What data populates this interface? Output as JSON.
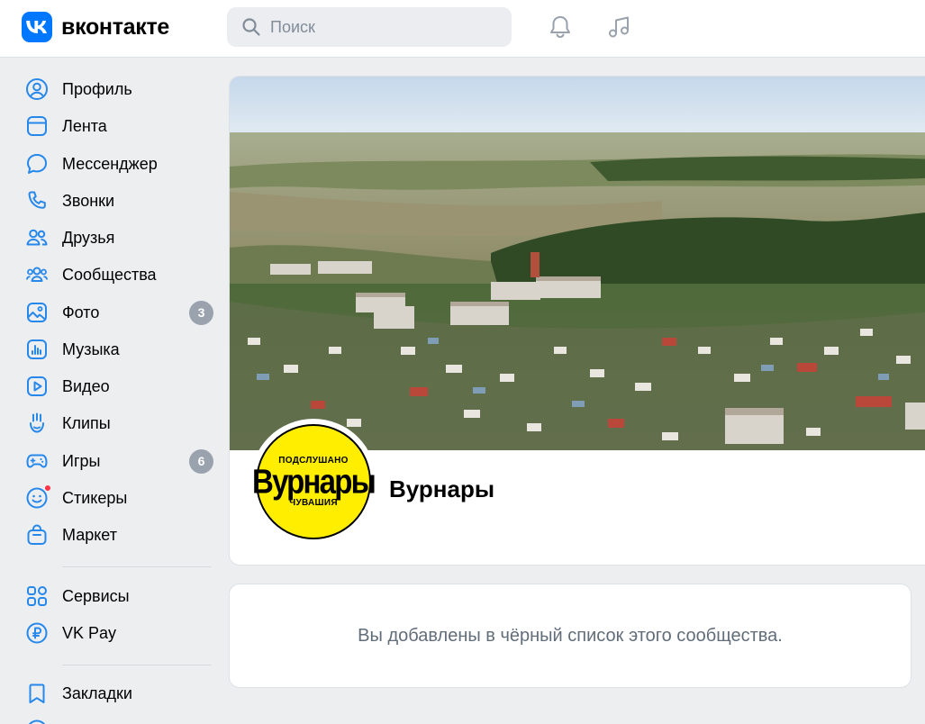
{
  "header": {
    "logo_text": "вконтакте",
    "search_placeholder": "Поиск",
    "icons": [
      "vk-logo-icon",
      "search-icon",
      "bell-icon",
      "music-note-icon"
    ]
  },
  "sidebar": {
    "items": [
      {
        "label": "Профиль",
        "icon": "profile-icon"
      },
      {
        "label": "Лента",
        "icon": "feed-icon"
      },
      {
        "label": "Мессенджер",
        "icon": "messenger-icon"
      },
      {
        "label": "Звонки",
        "icon": "phone-icon"
      },
      {
        "label": "Друзья",
        "icon": "friends-icon"
      },
      {
        "label": "Сообщества",
        "icon": "communities-icon"
      },
      {
        "label": "Фото",
        "icon": "photo-icon",
        "badge": "3"
      },
      {
        "label": "Музыка",
        "icon": "music-icon"
      },
      {
        "label": "Видео",
        "icon": "video-icon"
      },
      {
        "label": "Клипы",
        "icon": "clips-icon"
      },
      {
        "label": "Игры",
        "icon": "games-icon",
        "badge": "6"
      },
      {
        "label": "Стикеры",
        "icon": "stickers-icon"
      },
      {
        "label": "Маркет",
        "icon": "market-icon"
      }
    ],
    "secondary_items": [
      {
        "label": "Сервисы",
        "icon": "services-icon"
      },
      {
        "label": "VK Pay",
        "icon": "vk-pay-icon"
      }
    ],
    "tertiary_items": [
      {
        "label": "Закладки",
        "icon": "bookmark-icon"
      }
    ]
  },
  "group": {
    "name": "Вурнары",
    "avatar_text": {
      "top": "ПОДСЛУШАНО",
      "main": "Вурнары",
      "bottom": "ЧУВАШИЯ"
    }
  },
  "message": {
    "text": "Вы добавлены в чёрный список этого сообщества."
  },
  "colors": {
    "accent": "#0077ff",
    "icon_blue": "#2688eb",
    "background": "#edeef0",
    "badge": "#99a2ad",
    "notification_dot": "#ff3347",
    "avatar_yellow": "#ffee00",
    "muted_text": "#626d7a"
  }
}
